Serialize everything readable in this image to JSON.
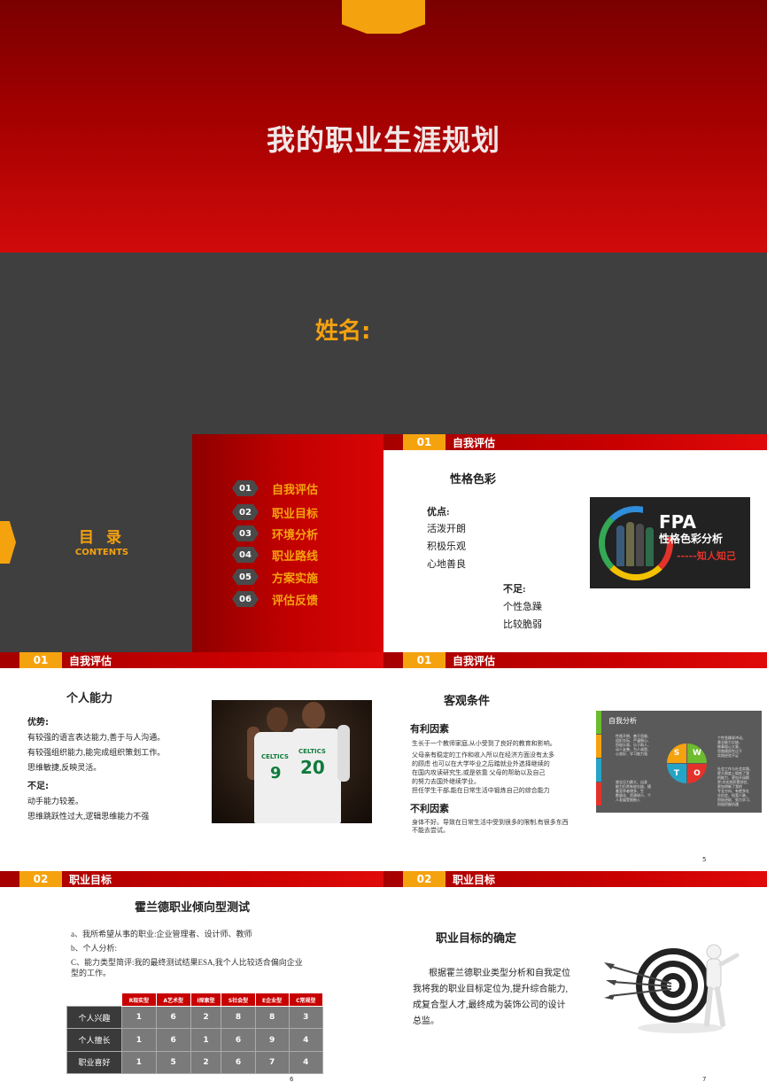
{
  "title_slide": {
    "title": "我的职业生涯规划"
  },
  "name_slide": {
    "label": "姓名:"
  },
  "toc": {
    "title": "目 录",
    "subtitle": "CONTENTS",
    "items": [
      {
        "num": "01",
        "label": "自我评估"
      },
      {
        "num": "02",
        "label": "职业目标"
      },
      {
        "num": "03",
        "label": "环境分析"
      },
      {
        "num": "04",
        "label": "职业路线"
      },
      {
        "num": "05",
        "label": "方案实施"
      },
      {
        "num": "06",
        "label": "评估反馈"
      }
    ]
  },
  "personality_slide": {
    "section_num": "01",
    "section_title": "自我评估",
    "heading": "性格色彩",
    "strengths_label": "优点:",
    "strengths": [
      "活泼开朗",
      "积极乐观",
      "心地善良"
    ],
    "weakness_label": "不足:",
    "weaknesses": [
      "个性急躁",
      "比较脆弱"
    ],
    "logo": {
      "title": "FPA",
      "subtitle": "性格色彩分析",
      "tagline": "-----知人知己"
    }
  },
  "ability_slide": {
    "section_num": "01",
    "section_title": "自我评估",
    "heading": "个人能力",
    "strengths_label": "优势:",
    "strengths": [
      "有较强的语言表达能力,善于与人沟通。",
      "有较强组织能力,能完成组织策划工作。",
      "思维敏捷,反映灵活。"
    ],
    "weakness_label": "不足:",
    "weaknesses": [
      "动手能力较差。",
      "思维跳跃性过大,逻辑思维能力不强"
    ],
    "photo": {
      "jersey_word": "CELTICS",
      "number_left": "9",
      "number_right": "20"
    }
  },
  "conditions_slide": {
    "section_num": "01",
    "section_title": "自我评估",
    "heading": "客观条件",
    "favorable_label": "有利因素",
    "favorable_lines": [
      "生长于一个教师家庭,从小受到了良好的教育和影响。",
      "父母亲有稳定的工作和收入所以在经济方面没有太多",
      "的顾虑    也可以在大学毕业之后踏就业外选择继续的",
      "在国内攻读研究生,或是依靠 父母的帮助以及自己",
      "的努力去国外继续学业。",
      "担任学生干部,能在日常生活中锻炼自己的综合能力"
    ],
    "unfavorable_label": "不利因素",
    "unfavorable_lines": [
      "身体不好。导致在日常生活中受到很多的限制,有很多东西",
      "不能去尝试。"
    ],
    "swot": {
      "title": "自我分析",
      "letters": [
        "S",
        "W",
        "T",
        "O"
      ],
      "colors": [
        "#f5a20f",
        "#6dbb2e",
        "#25a4c8",
        "#e3322b"
      ],
      "note_left_top": [
        "性格开朗、善于思维、",
        "组织交际、严谨细心、",
        "积极乐观、乐于助人、",
        "动人友善、为人诚恳、",
        "心态好、学习能力强"
      ],
      "note_right_top": [
        "个性急躁易冲动、",
        "意志能力欠缺、",
        "做事粗心大意、",
        "思路跳跃性过于",
        "实践经验不足"
      ],
      "note_left_bottom": [
        "就业压力颇大、自身",
        "能力仍然有较欠缺、随",
        "着竞争者增多、生",
        "数量化、资源较少、个",
        "人发展受限制入"
      ],
      "note_right_bottom": [
        "社会工作与社会实践、",
        "更大限度上锻炼了我",
        "的能力、更加开阔眼",
        "界;对实践积累经验、",
        "更加明晰了我的",
        "专业方向、有更多社",
        "交机会、拓宽人脉、",
        "积极进取、努力学习、",
        "积极把握机遇"
      ]
    },
    "page": "5"
  },
  "holland_slide": {
    "section_num": "02",
    "section_title": "职业目标",
    "heading": "霍兰德职业倾向型测试",
    "lines": [
      "a、我所希望从事的职业:企业管理者、设计师、教师",
      "b、个人分析:",
      "C、能力类型简评:我的最终测试结果ESA,我个人比较适合偏向企业",
      "型的工作。"
    ],
    "table": {
      "columns": [
        "R现实型",
        "A艺术型",
        "I探索型",
        "S社会型",
        "E企业型",
        "C常规型"
      ],
      "rows": [
        {
          "label": "个人兴趣",
          "values": [
            "1",
            "6",
            "2",
            "8",
            "8",
            "3"
          ]
        },
        {
          "label": "个人擅长",
          "values": [
            "1",
            "6",
            "1",
            "6",
            "9",
            "4"
          ]
        },
        {
          "label": "职业喜好",
          "values": [
            "1",
            "5",
            "2",
            "6",
            "7",
            "4"
          ]
        }
      ]
    },
    "page": "6"
  },
  "goal_slide": {
    "section_num": "02",
    "section_title": "职业目标",
    "heading": "职业目标的确定",
    "lines": [
      "根据霍兰德职业类型分析和自我定位",
      "我将我的职业目标定位为,提升综合能力,",
      "成复合型人才,最终成为装饰公司的设计",
      "总监。"
    ],
    "page": "7"
  },
  "colors": {
    "brand_red": "#c80000",
    "accent_orange": "#f5a20f",
    "dark_gray": "#3f3f3f"
  }
}
